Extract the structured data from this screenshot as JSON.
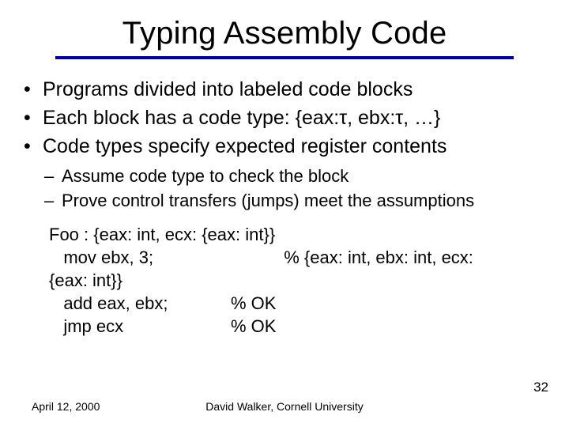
{
  "title": "Typing Assembly Code",
  "bullets": [
    "Programs divided into labeled code blocks",
    "Each block has a code type: {eax:τ, ebx:τ, …}",
    "Code types specify expected register contents"
  ],
  "subbullets": [
    "Assume code type to check the block",
    "Prove control transfers (jumps) meet the assumptions"
  ],
  "code": {
    "signature": "Foo : {eax: int, ecx: {eax: int}}",
    "line1_left": "   mov ebx, 3;",
    "line1_right": "           % {eax: int, ebx: int, ecx:",
    "line2_wrap": "{eax: int}}",
    "line3_left": "   add eax, ebx;",
    "line3_right": "% OK",
    "line4_left": "   jmp ecx",
    "line4_right": "% OK"
  },
  "footer": {
    "date": "April 12, 2000",
    "center": "David Walker, Cornell University"
  },
  "page_number": "32"
}
